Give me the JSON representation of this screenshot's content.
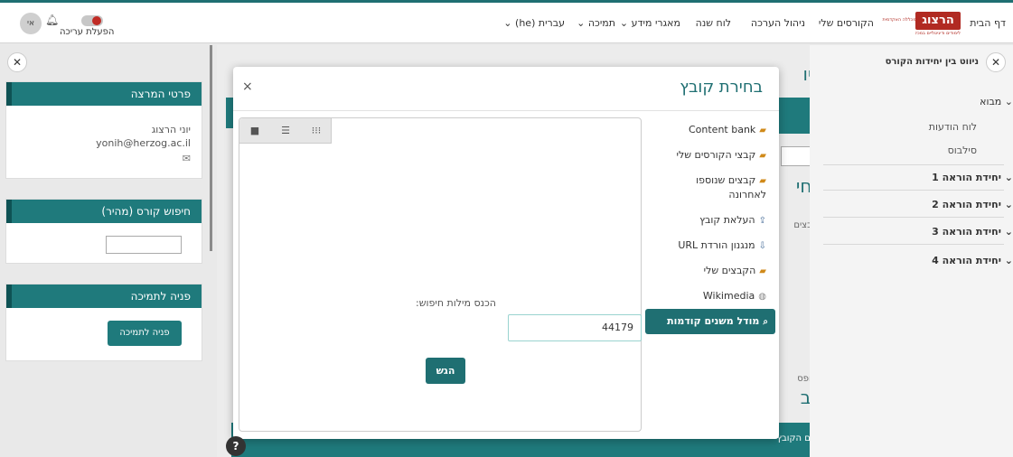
{
  "nav": {
    "logo": "הרצוג",
    "logo_sub": "לימודים ודיגיטליים במכללה",
    "logo_top": "המכללה האקדמית",
    "home": "דף הבית",
    "my_courses": "הקורסים שלי",
    "assessment": "ניהול הערכה",
    "calendar": "לוח שנה",
    "info": "מאגרי מידע",
    "support": "תמיכה",
    "language": "עברית (he)",
    "edit_mode": "הפעלת עריכה",
    "avatar": "אי"
  },
  "left": {
    "lecturer_title": "פרטי המרצה",
    "lecturer_name": "יוני הרצוג",
    "lecturer_email": "yonih@herzog.ac.il",
    "search_title": "חיפוש קורס (מהיר)",
    "support_title": "פניה לתמיכה",
    "support_button": "פניה לתמיכה"
  },
  "right": {
    "nav_title": "ניווט בין יחידות הקורס",
    "intro": "מבוא",
    "announcements": "לוח הודעות",
    "syllabus": "סילבוס",
    "unit1": "יחידת הוראה 1",
    "unit2": "יחידת הוראה 2",
    "unit3": "יחידת הוראה 3",
    "unit4": "יחידת הוראה 4"
  },
  "behind": {
    "h1": "ביו",
    "h2": "בחי",
    "small": "קבצים",
    "added": "בטופס",
    "h3": "גיב",
    "col_name": "שם הקובץ"
  },
  "modal": {
    "title": "בחירת קובץ",
    "close": "×",
    "repos": [
      "Content bank",
      "קבצי הקורסים שלי",
      "קבצים שנוספו לאחרונה",
      "העלאת קובץ",
      "מנגנון הורדת URL",
      "הקבצים שלי",
      "Wikimedia",
      "מודל משנים קודמות"
    ],
    "search_label": "הכנס מילות חיפוש:",
    "search_value": "44179",
    "submit": "הגש"
  },
  "help": "?"
}
